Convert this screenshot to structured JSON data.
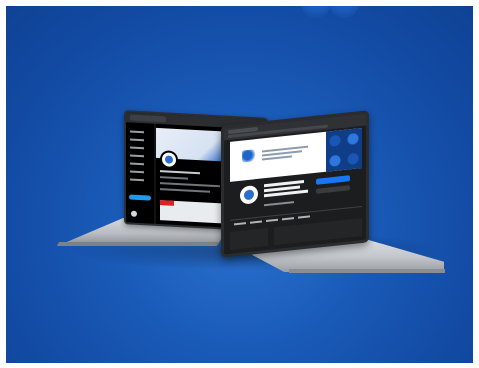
{
  "scene": {
    "background_color": "#1a5bb8",
    "frame_color": "#ffffff"
  },
  "laptop_left": {
    "screen_content": "x-profile-page",
    "sidebar_accent": "#1d9bf0",
    "banner_colors": [
      "#e8eef7",
      "#2b68c6"
    ]
  },
  "laptop_right": {
    "screen_content": "facebook-page",
    "follow_button_color": "#1877f2",
    "cover_pattern_colors": [
      "#0f3d88",
      "#1b56b4",
      "#2d78da"
    ]
  },
  "icons": {
    "left_avatar": "organization-logo-icon",
    "right_avatar": "organization-logo-icon"
  }
}
